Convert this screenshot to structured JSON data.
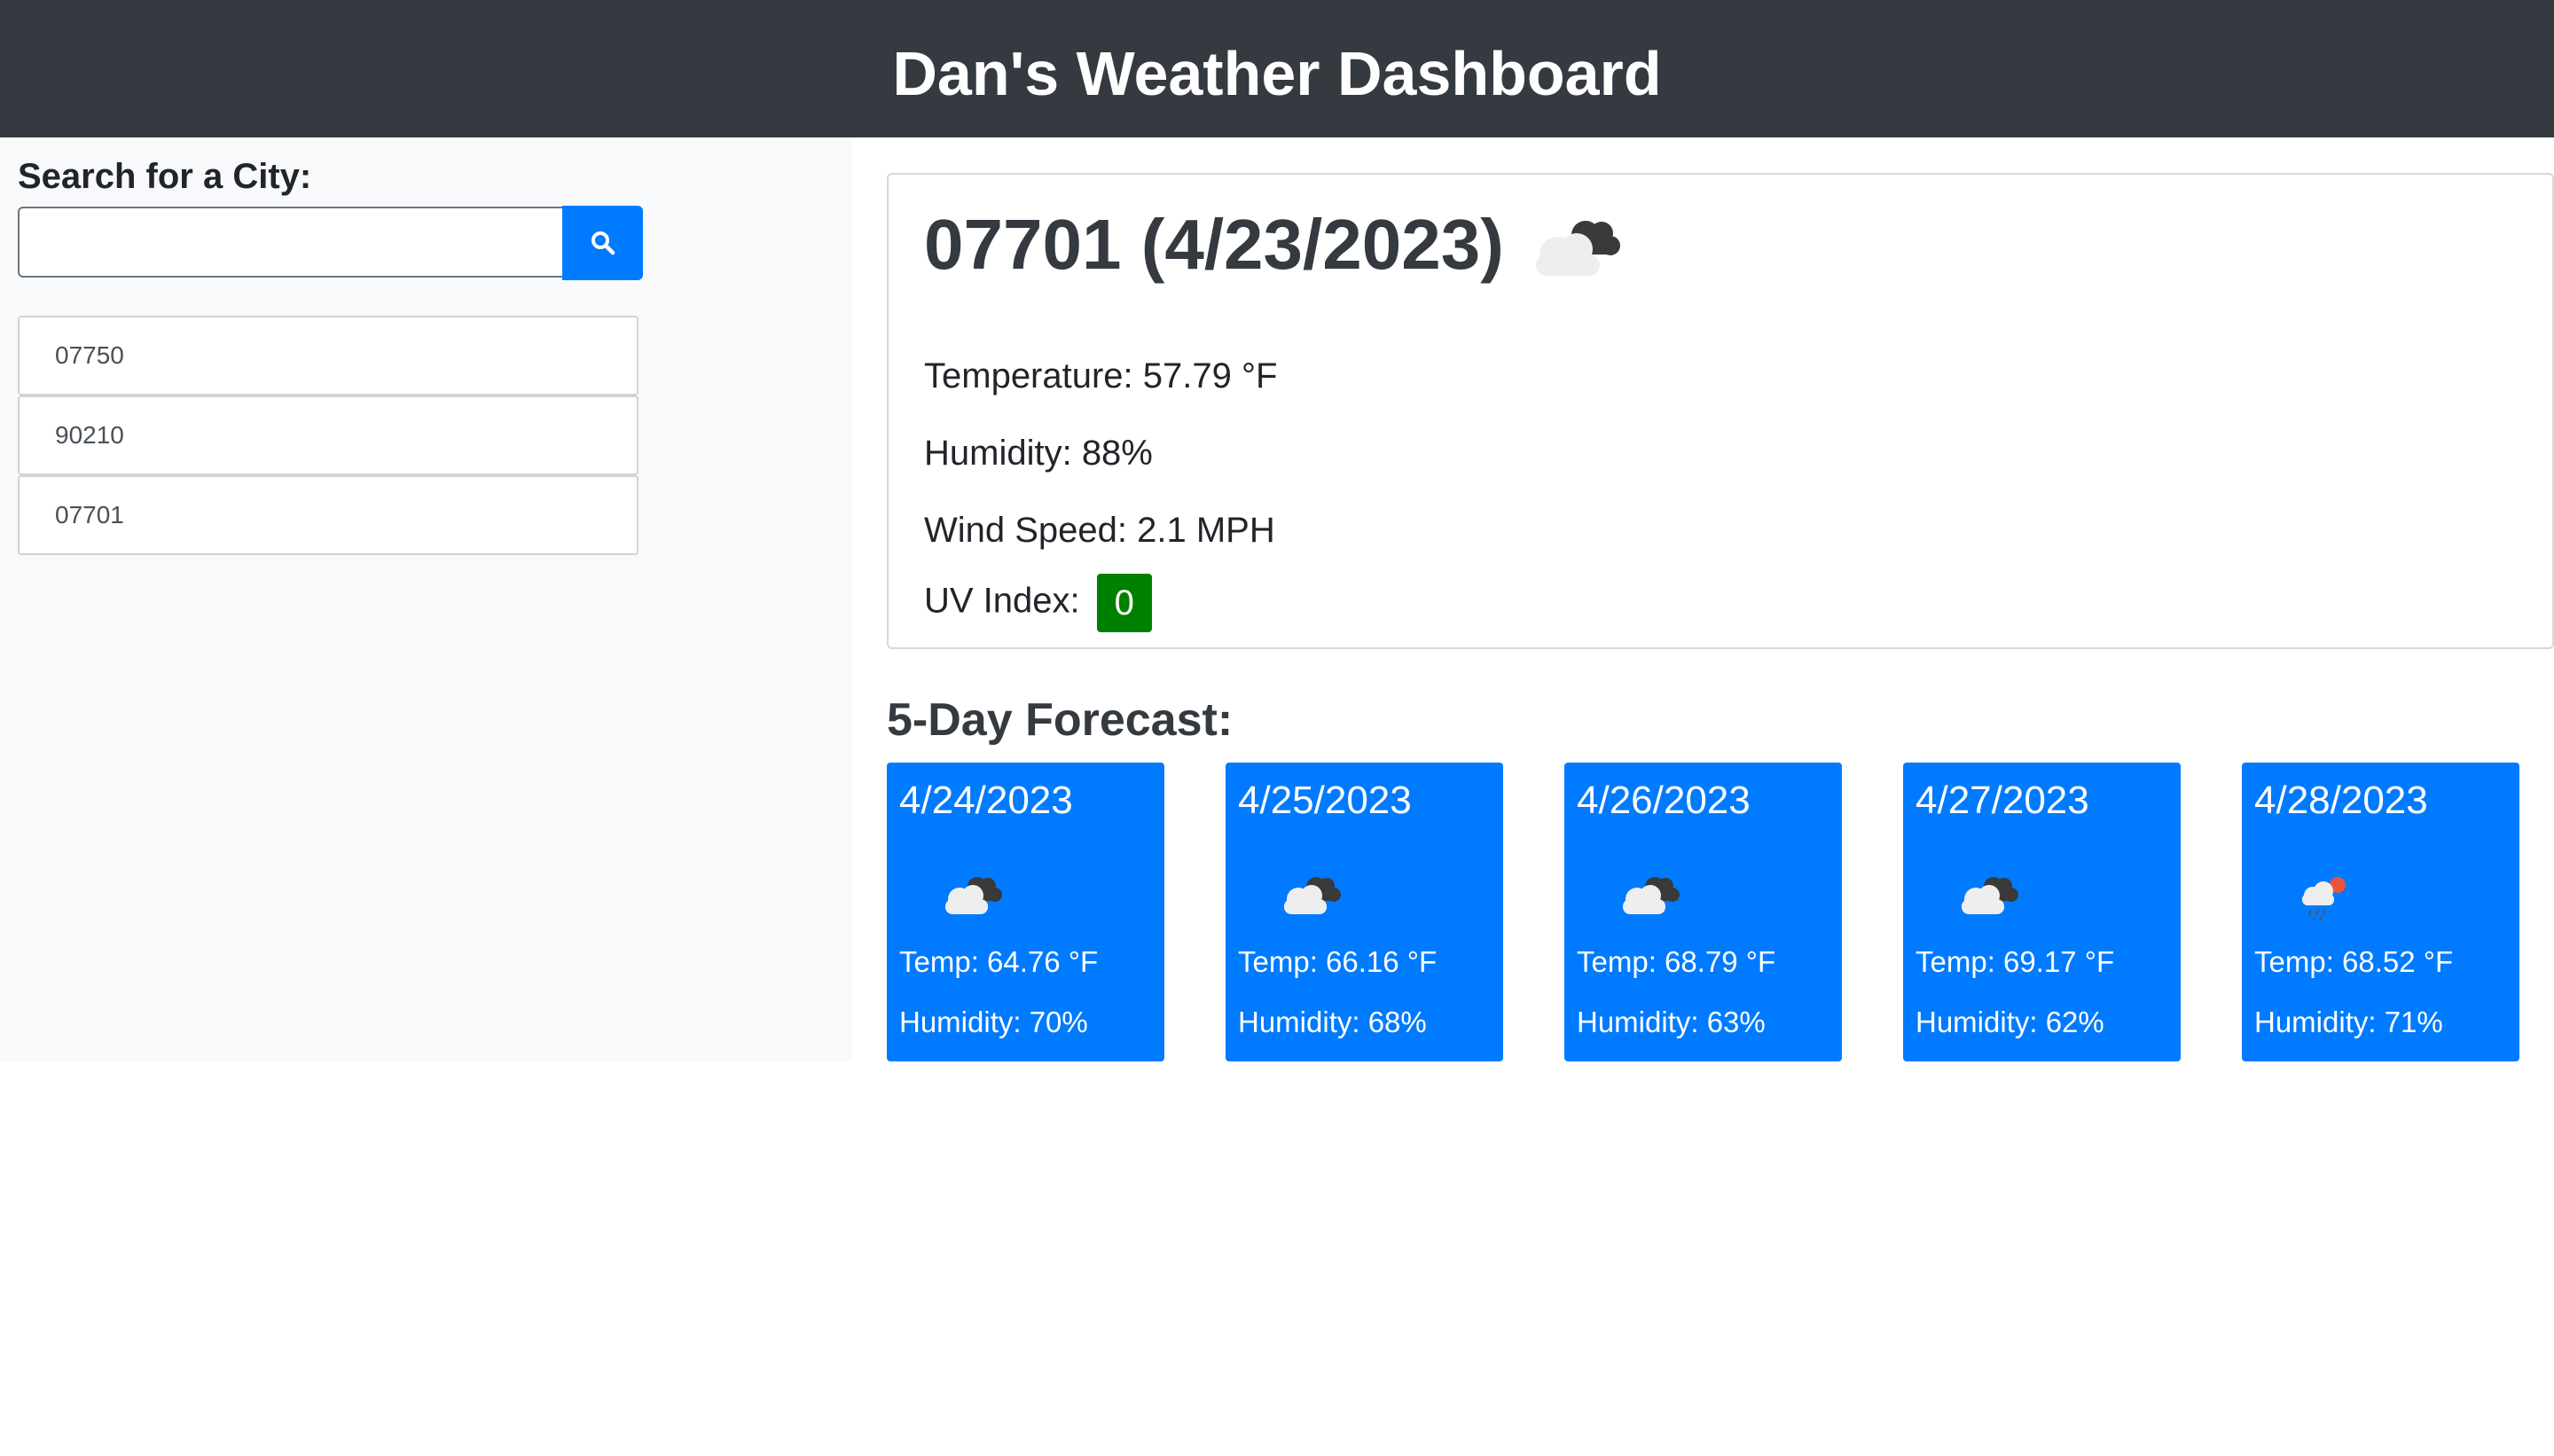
{
  "header": {
    "title": "Dan's Weather Dashboard"
  },
  "search": {
    "label": "Search for a City:",
    "value": "",
    "placeholder": "",
    "button_icon": "search-icon"
  },
  "history": [
    "07750",
    "90210",
    "07701"
  ],
  "current": {
    "title": "07701 (4/23/2023)",
    "icon": "cloudy-icon",
    "temperature": "Temperature: 57.79 °F",
    "humidity": "Humidity: 88%",
    "wind": "Wind Speed: 2.1 MPH",
    "uv_label": "UV Index:",
    "uv_value": "0",
    "uv_color": "#008000"
  },
  "forecast": {
    "heading": "5-Day Forecast:",
    "days": [
      {
        "date": "4/24/2023",
        "icon": "cloudy-icon",
        "temp": "Temp: 64.76 °F",
        "humidity": "Humidity: 70%"
      },
      {
        "date": "4/25/2023",
        "icon": "cloudy-icon",
        "temp": "Temp: 66.16 °F",
        "humidity": "Humidity: 68%"
      },
      {
        "date": "4/26/2023",
        "icon": "cloudy-icon",
        "temp": "Temp: 68.79 °F",
        "humidity": "Humidity: 63%"
      },
      {
        "date": "4/27/2023",
        "icon": "cloudy-icon",
        "temp": "Temp: 69.17 °F",
        "humidity": "Humidity: 62%"
      },
      {
        "date": "4/28/2023",
        "icon": "rain-sun-icon",
        "temp": "Temp: 68.52 °F",
        "humidity": "Humidity: 71%"
      }
    ]
  },
  "colors": {
    "header_bg": "#343a40",
    "accent": "#007bff",
    "sidebar_bg": "#f8f9fa"
  }
}
